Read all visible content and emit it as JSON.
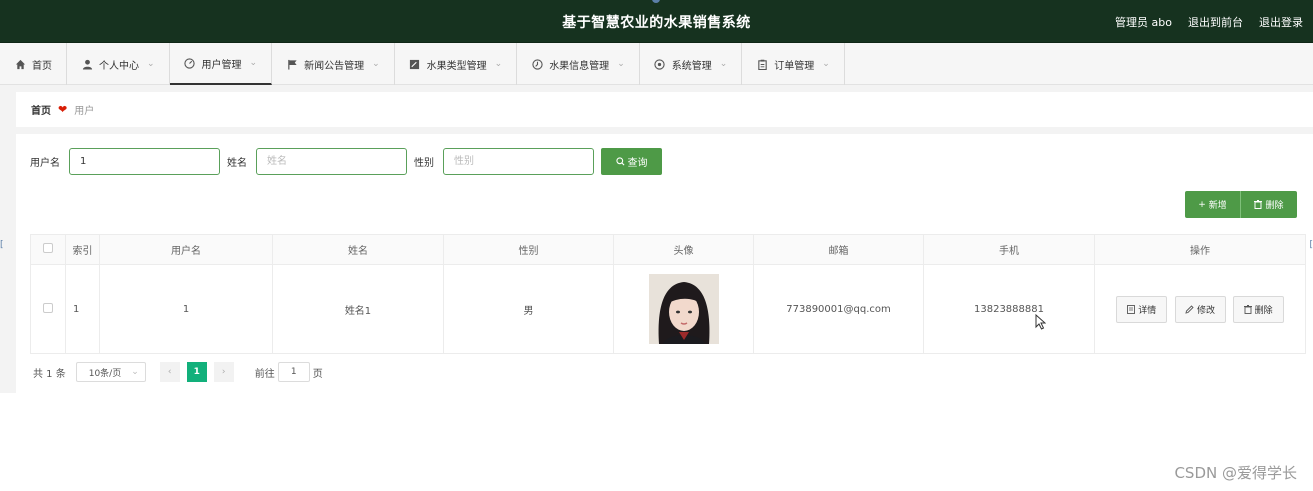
{
  "header": {
    "title": "基于智慧农业的水果销售系统",
    "user_label": "管理员 abo",
    "front_link": "退出到前台",
    "logout_link": "退出登录"
  },
  "nav": {
    "items": [
      {
        "label": "首页",
        "icon": "home-icon"
      },
      {
        "label": "个人中心",
        "icon": "person-icon"
      },
      {
        "label": "用户管理",
        "icon": "dashboard-icon"
      },
      {
        "label": "新闻公告管理",
        "icon": "flag-icon"
      },
      {
        "label": "水果类型管理",
        "icon": "edit-icon"
      },
      {
        "label": "水果信息管理",
        "icon": "clock-icon"
      },
      {
        "label": "系统管理",
        "icon": "settings-icon"
      },
      {
        "label": "订单管理",
        "icon": "clipboard-icon"
      }
    ],
    "active_index": 2
  },
  "breadcrumb": {
    "home": "首页",
    "current": "用户"
  },
  "search": {
    "username_label": "用户名",
    "username_value": "1",
    "name_label": "姓名",
    "name_placeholder": "姓名",
    "gender_label": "性别",
    "gender_placeholder": "性别",
    "search_button": "查询"
  },
  "actions": {
    "add_button": "新增",
    "delete_button": "删除"
  },
  "table": {
    "headers": [
      "索引",
      "用户名",
      "姓名",
      "性别",
      "头像",
      "邮箱",
      "手机",
      "操作"
    ],
    "rows": [
      {
        "index": "1",
        "username": "1",
        "name": "姓名1",
        "gender": "男",
        "email": "773890001@qq.com",
        "phone": "13823888881",
        "ops": [
          "详情",
          "修改",
          "删除"
        ]
      }
    ]
  },
  "pager": {
    "total": "共 1 条",
    "page_size": "10条/页",
    "current_page": "1",
    "goto_label": "前往",
    "goto_value": "1",
    "page_suffix": "页"
  },
  "watermark": "CSDN @爱得学长",
  "colors": {
    "header_bg": "#16321f",
    "primary_green": "#4e9a47",
    "pager_active": "#12b07b"
  }
}
